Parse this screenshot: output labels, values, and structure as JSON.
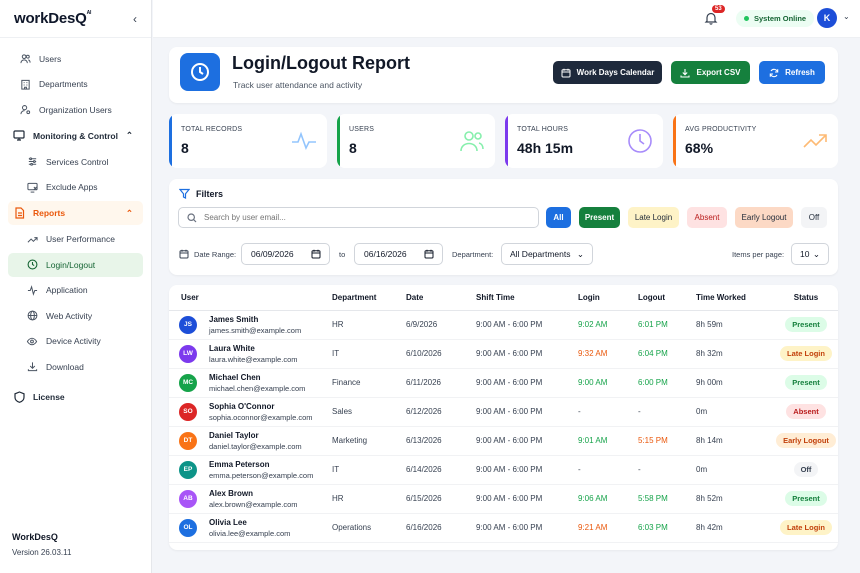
{
  "app": {
    "logo": "workDesQ",
    "logo_sup": "AI",
    "brand": "WorkDesQ",
    "version": "Version 26.03.11"
  },
  "sidebar": {
    "items": [
      {
        "label": "Users",
        "icon": "users-icon"
      },
      {
        "label": "Departments",
        "icon": "building-icon"
      },
      {
        "label": "Organization Users",
        "icon": "user-cog-icon"
      }
    ],
    "monitoring": {
      "label": "Monitoring & Control",
      "items": [
        {
          "label": "Services Control"
        },
        {
          "label": "Exclude Apps"
        }
      ]
    },
    "reports": {
      "label": "Reports",
      "items": [
        {
          "label": "User Performance"
        },
        {
          "label": "Login/Logout"
        },
        {
          "label": "Application"
        },
        {
          "label": "Web Activity"
        },
        {
          "label": "Device Activity"
        },
        {
          "label": "Download"
        }
      ]
    },
    "license": "License"
  },
  "topbar": {
    "notifications": "53",
    "status": "System Online",
    "avatar": "K"
  },
  "header": {
    "title": "Login/Logout Report",
    "subtitle": "Track user attendance and activity",
    "buttons": {
      "calendar": "Work Days Calendar",
      "csv": "Export CSV",
      "refresh": "Refresh"
    }
  },
  "stats": [
    {
      "label": "TOTAL RECORDS",
      "value": "8",
      "color": "#1d6fe0"
    },
    {
      "label": "USERS",
      "value": "8",
      "color": "#16a34a"
    },
    {
      "label": "TOTAL HOURS",
      "value": "48h 15m",
      "color": "#7c3aed"
    },
    {
      "label": "AVG PRODUCTIVITY",
      "value": "68%",
      "color": "#f97316"
    }
  ],
  "filters": {
    "title": "Filters",
    "search_placeholder": "Search by user email...",
    "chips": {
      "all": "All",
      "present": "Present",
      "late": "Late Login",
      "absent": "Absent",
      "early": "Early Logout",
      "off": "Off"
    },
    "date_range_label": "Date Range:",
    "date_from": "06/09/2026",
    "to_label": "to",
    "date_to": "06/16/2026",
    "department_label": "Department:",
    "department_value": "All Departments",
    "per_page_label": "Items per page:",
    "per_page_value": "10"
  },
  "table": {
    "headers": {
      "user": "User",
      "department": "Department",
      "date": "Date",
      "shift": "Shift Time",
      "login": "Login",
      "logout": "Logout",
      "worked": "Time Worked",
      "status": "Status"
    },
    "rows": [
      {
        "initials": "JS",
        "av": "#1d4ed8",
        "name": "James Smith",
        "email": "james.smith@example.com",
        "department": "HR",
        "date": "6/9/2026",
        "shift": "9:00 AM - 6:00 PM",
        "login": "9:02 AM",
        "login_color": "#16a34a",
        "logout": "6:01 PM",
        "logout_color": "#16a34a",
        "worked": "8h 59m",
        "status": "Present",
        "status_bg": "#dcfce7",
        "status_fg": "#15803d"
      },
      {
        "initials": "LW",
        "av": "#7c3aed",
        "name": "Laura White",
        "email": "laura.white@example.com",
        "department": "IT",
        "date": "6/10/2026",
        "shift": "9:00 AM - 6:00 PM",
        "login": "9:32 AM",
        "login_color": "#ea580c",
        "logout": "6:04 PM",
        "logout_color": "#16a34a",
        "worked": "8h 32m",
        "status": "Late Login",
        "status_bg": "#fef3c7",
        "status_fg": "#c2410c"
      },
      {
        "initials": "MC",
        "av": "#16a34a",
        "name": "Michael Chen",
        "email": "michael.chen@example.com",
        "department": "Finance",
        "date": "6/11/2026",
        "shift": "9:00 AM - 6:00 PM",
        "login": "9:00 AM",
        "login_color": "#16a34a",
        "logout": "6:00 PM",
        "logout_color": "#16a34a",
        "worked": "9h 00m",
        "status": "Present",
        "status_bg": "#dcfce7",
        "status_fg": "#15803d"
      },
      {
        "initials": "SO",
        "av": "#dc2626",
        "name": "Sophia O'Connor",
        "email": "sophia.oconnor@example.com",
        "department": "Sales",
        "date": "6/12/2026",
        "shift": "9:00 AM - 6:00 PM",
        "login": "-",
        "login_color": "#374151",
        "logout": "-",
        "logout_color": "#374151",
        "worked": "0m",
        "status": "Absent",
        "status_bg": "#fee2e2",
        "status_fg": "#b91c1c"
      },
      {
        "initials": "DT",
        "av": "#f97316",
        "name": "Daniel Taylor",
        "email": "daniel.taylor@example.com",
        "department": "Marketing",
        "date": "6/13/2026",
        "shift": "9:00 AM - 6:00 PM",
        "login": "9:01 AM",
        "login_color": "#16a34a",
        "logout": "5:15 PM",
        "logout_color": "#ea580c",
        "worked": "8h 14m",
        "status": "Early Logout",
        "status_bg": "#ffedd5",
        "status_fg": "#c2410c"
      },
      {
        "initials": "EP",
        "av": "#0d9488",
        "name": "Emma Peterson",
        "email": "emma.peterson@example.com",
        "department": "IT",
        "date": "6/14/2026",
        "shift": "9:00 AM - 6:00 PM",
        "login": "-",
        "login_color": "#374151",
        "logout": "-",
        "logout_color": "#374151",
        "worked": "0m",
        "status": "Off",
        "status_bg": "#f3f4f6",
        "status_fg": "#374151"
      },
      {
        "initials": "AB",
        "av": "#a855f7",
        "name": "Alex Brown",
        "email": "alex.brown@example.com",
        "department": "HR",
        "date": "6/15/2026",
        "shift": "9:00 AM - 6:00 PM",
        "login": "9:06 AM",
        "login_color": "#16a34a",
        "logout": "5:58 PM",
        "logout_color": "#16a34a",
        "worked": "8h 52m",
        "status": "Present",
        "status_bg": "#dcfce7",
        "status_fg": "#15803d"
      },
      {
        "initials": "OL",
        "av": "#1d6fe0",
        "name": "Olivia Lee",
        "email": "olivia.lee@example.com",
        "department": "Operations",
        "date": "6/16/2026",
        "shift": "9:00 AM - 6:00 PM",
        "login": "9:21 AM",
        "login_color": "#ea580c",
        "logout": "6:03 PM",
        "logout_color": "#16a34a",
        "worked": "8h 42m",
        "status": "Late Login",
        "status_bg": "#fef3c7",
        "status_fg": "#c2410c"
      }
    ]
  }
}
